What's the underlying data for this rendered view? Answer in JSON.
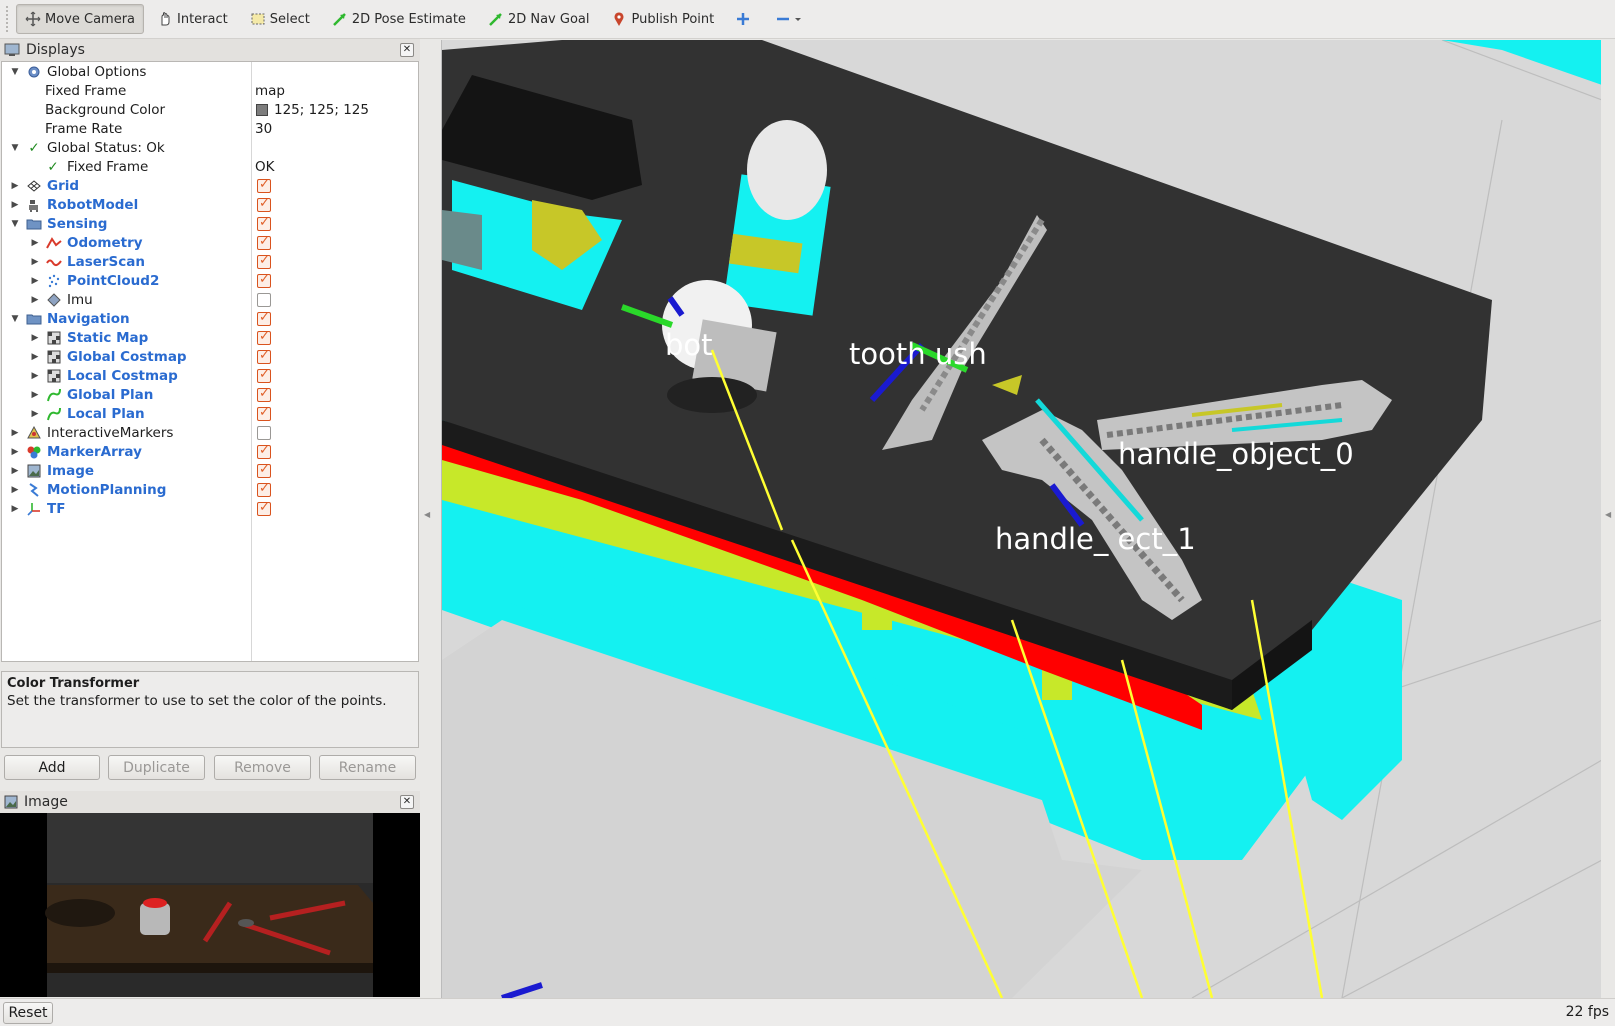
{
  "toolbar": {
    "tools": [
      {
        "label": "Move Camera",
        "icon": "move-camera-icon"
      },
      {
        "label": "Interact",
        "icon": "hand-icon"
      },
      {
        "label": "Select",
        "icon": "select-box-icon"
      },
      {
        "label": "2D Pose Estimate",
        "icon": "green-arrow-icon"
      },
      {
        "label": "2D Nav Goal",
        "icon": "green-arrow-icon"
      },
      {
        "label": "Publish Point",
        "icon": "map-pin-icon"
      }
    ]
  },
  "displays": {
    "title": "Displays",
    "global_options": "Global Options",
    "fixed_frame_label": "Fixed Frame",
    "fixed_frame_value": "map",
    "background_color_label": "Background Color",
    "background_color_value": "125; 125; 125",
    "frame_rate_label": "Frame Rate",
    "frame_rate_value": "30",
    "global_status": "Global Status: Ok",
    "status_fixed_frame": "Fixed Frame",
    "status_fixed_frame_value": "OK",
    "items": [
      {
        "label": "Grid",
        "checked": true
      },
      {
        "label": "RobotModel",
        "checked": true
      },
      {
        "label": "Sensing",
        "checked": true
      },
      {
        "label": "Odometry",
        "checked": true
      },
      {
        "label": "LaserScan",
        "checked": true
      },
      {
        "label": "PointCloud2",
        "checked": true
      },
      {
        "label": "Imu",
        "checked": false
      },
      {
        "label": "Navigation",
        "checked": true
      },
      {
        "label": "Static Map",
        "checked": true
      },
      {
        "label": "Global Costmap",
        "checked": true
      },
      {
        "label": "Local Costmap",
        "checked": true
      },
      {
        "label": "Global Plan",
        "checked": true
      },
      {
        "label": "Local Plan",
        "checked": true
      },
      {
        "label": "InteractiveMarkers",
        "checked": false
      },
      {
        "label": "MarkerArray",
        "checked": true
      },
      {
        "label": "Image",
        "checked": true
      },
      {
        "label": "MotionPlanning",
        "checked": true
      },
      {
        "label": "TF",
        "checked": true
      }
    ]
  },
  "description": {
    "title": "Color Transformer",
    "text": "Set the transformer to use to set the color of the points."
  },
  "panel_buttons": {
    "add": "Add",
    "duplicate": "Duplicate",
    "remove": "Remove",
    "rename": "Rename"
  },
  "image_panel": {
    "title": "Image"
  },
  "viewport": {
    "labels": {
      "bottle": "bot",
      "toothbrush": "tooth   ush",
      "handle0": "handle_object_0",
      "handle1": "handle_  ect_1"
    }
  },
  "status": {
    "reset": "Reset",
    "fps": "22 fps"
  }
}
